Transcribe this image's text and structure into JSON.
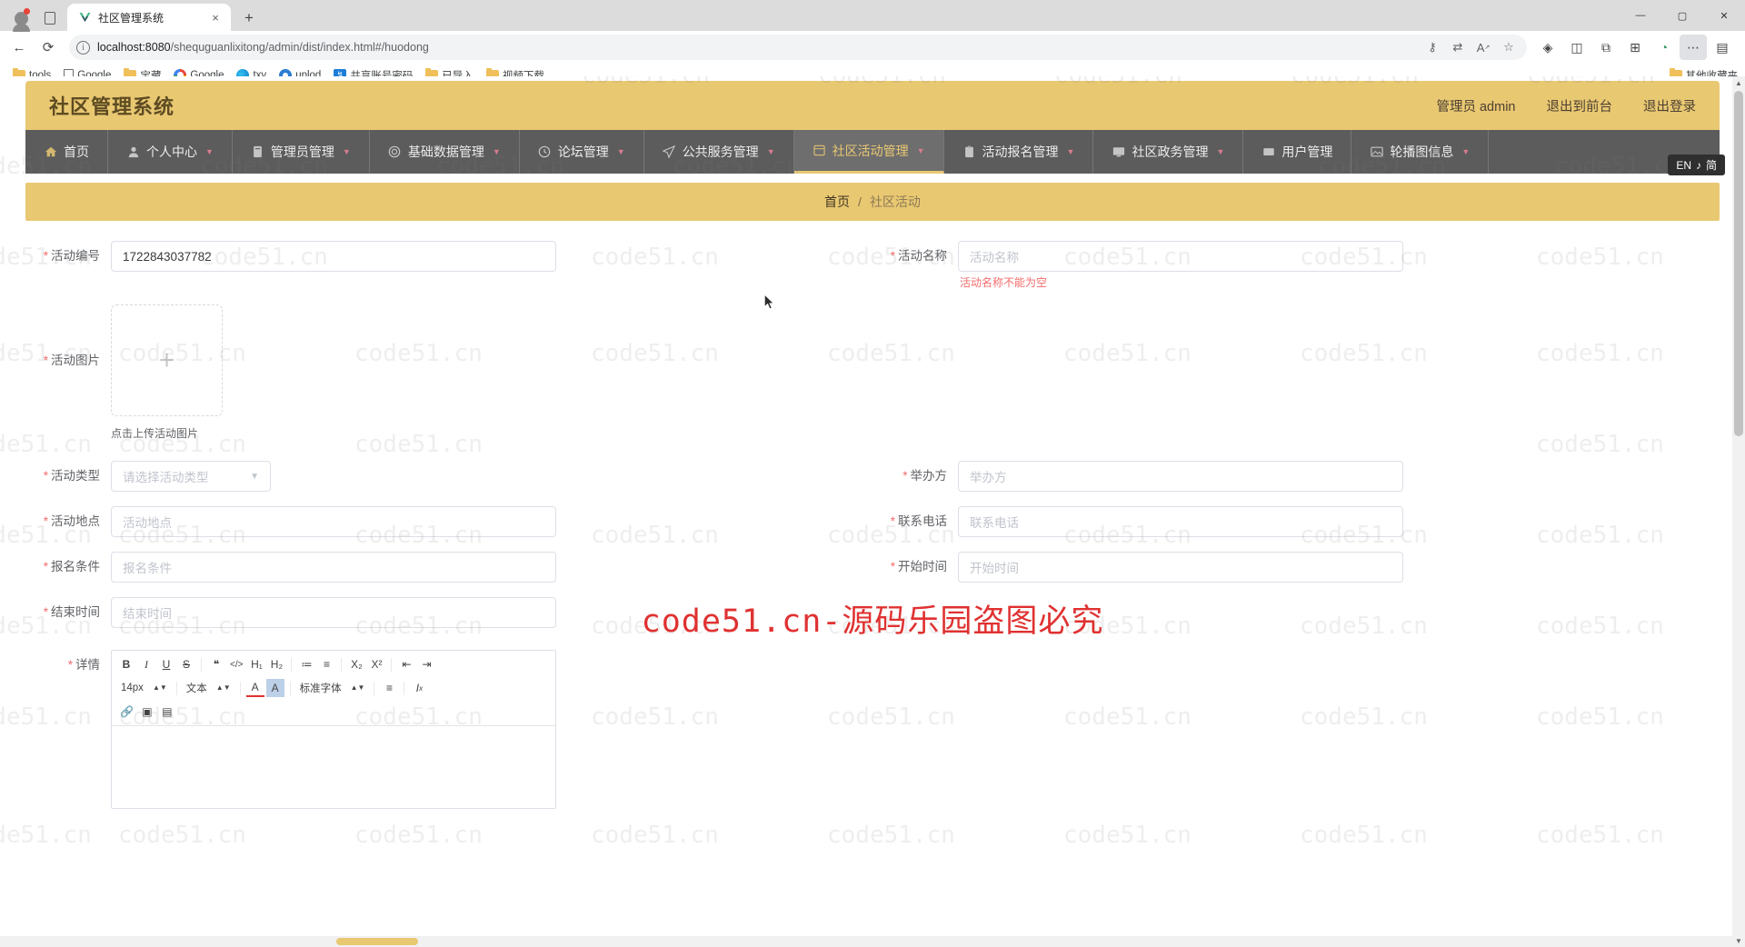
{
  "browser": {
    "tab": {
      "title": "社区管理系统",
      "favicon": "vue-logo-icon",
      "close": "×"
    },
    "new_tab": "+",
    "url_display": {
      "host": "localhost:8080",
      "path": "/shequguanlixitong/admin/dist/index.html#/huodong"
    },
    "window_controls": {
      "minimize": "—",
      "maximize": "▢",
      "close": "✕"
    },
    "toolbar_icons": [
      "key-icon",
      "translate-icon",
      "read-aloud-icon",
      "favorite-star-icon",
      "copilot-icon",
      "split-screen-icon",
      "collections-icon",
      "favorites-icon",
      "browser-essentials-icon",
      "settings-more-icon"
    ],
    "bookmarks": [
      {
        "label": "tools",
        "icon": "folder-icon"
      },
      {
        "label": "Google",
        "icon": "document-icon"
      },
      {
        "label": "宝藏",
        "icon": "folder-icon"
      },
      {
        "label": "Google",
        "icon": "google-icon"
      },
      {
        "label": "txy",
        "icon": "edge-icon"
      },
      {
        "label": "uplod",
        "icon": "blue-circle-icon"
      },
      {
        "label": "共享账号密码",
        "icon": "blue-square-icon"
      },
      {
        "label": "已导入",
        "icon": "folder-icon"
      },
      {
        "label": "视频下载",
        "icon": "folder-icon"
      }
    ],
    "bookmarks_overflow": {
      "label": "其他收藏夹",
      "icon": "folder-icon"
    }
  },
  "app": {
    "title": "社区管理系统",
    "header_links": [
      "管理员 admin",
      "退出到前台",
      "退出登录"
    ],
    "nav": [
      {
        "label": "首页",
        "icon": "home-icon",
        "has_caret": false,
        "active": false
      },
      {
        "label": "个人中心",
        "icon": "user-icon",
        "has_caret": true,
        "active": false
      },
      {
        "label": "管理员管理",
        "icon": "id-card-icon",
        "has_caret": true,
        "active": false
      },
      {
        "label": "基础数据管理",
        "icon": "database-icon",
        "has_caret": true,
        "active": false
      },
      {
        "label": "论坛管理",
        "icon": "clock-icon",
        "has_caret": true,
        "active": false
      },
      {
        "label": "公共服务管理",
        "icon": "send-icon",
        "has_caret": true,
        "active": false
      },
      {
        "label": "社区活动管理",
        "icon": "calendar-icon",
        "has_caret": true,
        "active": true
      },
      {
        "label": "活动报名管理",
        "icon": "clipboard-icon",
        "has_caret": true,
        "active": false
      },
      {
        "label": "社区政务管理",
        "icon": "monitor-icon",
        "has_caret": true,
        "active": false
      },
      {
        "label": "用户管理",
        "icon": "users-icon",
        "has_caret": false,
        "active": false
      },
      {
        "label": "轮播图信息",
        "icon": "image-icon",
        "has_caret": true,
        "active": false
      }
    ],
    "breadcrumb": {
      "root": "首页",
      "separator": "/",
      "current": "社区活动"
    },
    "lang_badge": {
      "text": "EN",
      "sub": "简",
      "icon": "ime-icon"
    }
  },
  "form": {
    "fields": {
      "activity_no": {
        "label": "活动编号",
        "required": true,
        "value": "1722843037782",
        "placeholder": "活动编号"
      },
      "activity_name": {
        "label": "活动名称",
        "required": true,
        "value": "",
        "placeholder": "活动名称",
        "error": "活动名称不能为空"
      },
      "activity_img": {
        "label": "活动图片",
        "required": true,
        "tip": "点击上传活动图片",
        "plus": "+"
      },
      "activity_type": {
        "label": "活动类型",
        "required": true,
        "value": "",
        "placeholder": "请选择活动类型"
      },
      "organizer": {
        "label": "举办方",
        "required": true,
        "value": "",
        "placeholder": "举办方"
      },
      "location": {
        "label": "活动地点",
        "required": true,
        "value": "",
        "placeholder": "活动地点"
      },
      "phone": {
        "label": "联系电话",
        "required": true,
        "value": "",
        "placeholder": "联系电话"
      },
      "condition": {
        "label": "报名条件",
        "required": true,
        "value": "",
        "placeholder": "报名条件"
      },
      "start_time": {
        "label": "开始时间",
        "required": true,
        "value": "",
        "placeholder": "开始时间"
      },
      "end_time": {
        "label": "结束时间",
        "required": true,
        "value": "",
        "placeholder": "结束时间"
      },
      "detail": {
        "label": "详情",
        "required": true,
        "value": ""
      }
    },
    "editor_toolbar": {
      "row1": [
        "B",
        "I",
        "U",
        "S",
        "❝",
        "</>",
        "H₁",
        "H₂",
        "≔",
        "≡",
        "X₂",
        "X²",
        "⇤",
        "⇥"
      ],
      "font_size": "14px",
      "text_style": "文本",
      "font_family": "标准字体",
      "row2_icons": [
        "text-color-icon",
        "highlight-icon",
        "align-icon",
        "clear-format-icon"
      ],
      "row3_icons": [
        "link-icon",
        "image-icon",
        "video-icon"
      ]
    }
  },
  "watermark": {
    "text": "code51.cn",
    "center_text": "code51.cn-源码乐园盗图必究"
  }
}
